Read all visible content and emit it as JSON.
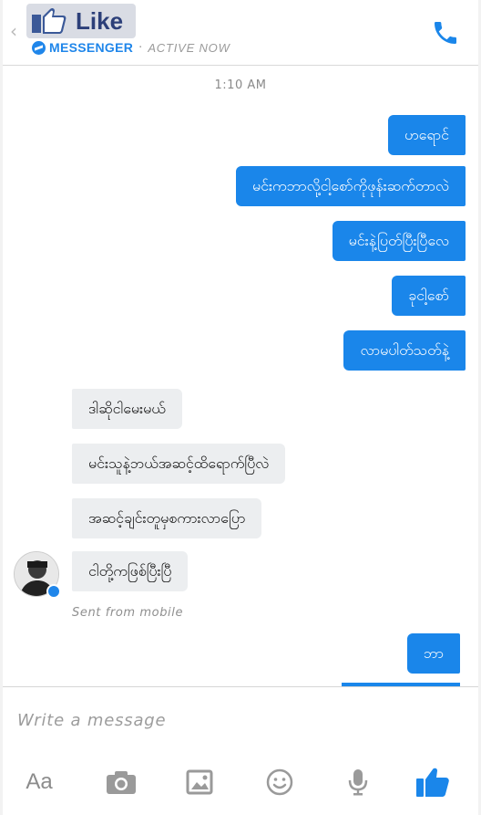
{
  "header": {
    "badge_text": "Like",
    "app_name": "MESSENGER",
    "status": "ACTIVE NOW"
  },
  "conversation": {
    "timestamp": "1:10 AM",
    "outgoing_top": [
      "ဟရောင်",
      "မင်းကဘာလို့ငါ့စော်ကိုဖုန်းဆက်တာလဲ",
      "မင်းနဲ့ပြတ်ပြီးပြီလေ",
      "ခုငါ့စော်",
      "လာမပါတ်သတ်နဲ့"
    ],
    "incoming": [
      "ဒါဆိုငါမေးမယ်",
      "မင်းသူနဲ့ဘယ်အဆင့်ထိရောက်ပြီလဲ",
      "အဆင့်ချင်းတူမှစကားလာပြော",
      "ငါတို့ကဖြစ်ပြီးပြီ"
    ],
    "sent_from": "Sent from mobile",
    "outgoing_bottom": [
      "ဘာ"
    ]
  },
  "composer": {
    "placeholder": "Write a message",
    "aa_label": "Aa"
  },
  "colors": {
    "accent": "#1a86ea",
    "incoming_bubble": "#eceef0",
    "like_badge_text": "#2c3f79"
  },
  "icons": [
    "back-chevron-icon",
    "thumbs-up-icon",
    "messenger-icon",
    "phone-icon",
    "camera-icon",
    "image-icon",
    "emoji-icon",
    "microphone-icon",
    "like-icon"
  ]
}
